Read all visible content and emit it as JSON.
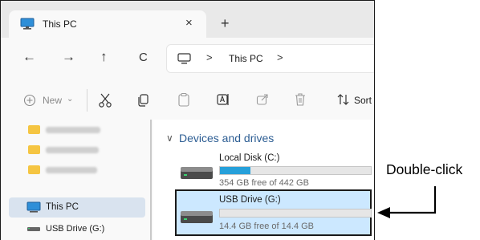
{
  "window": {
    "tab_title": "This PC",
    "tab_close": "×",
    "new_tab": "+"
  },
  "nav": {
    "back": "←",
    "forward": "→",
    "up": "↑",
    "refresh": "C",
    "sep": ">",
    "address_label": "This PC",
    "address_sep": ">"
  },
  "toolbar": {
    "new_label": "New",
    "sort_label": "Sort",
    "icons": [
      "plus-circle-icon",
      "cut-icon",
      "copy-icon",
      "paste-icon",
      "rename-icon",
      "share-icon",
      "delete-icon",
      "sort-icon"
    ]
  },
  "sidebar": {
    "this_pc": "This PC",
    "usb_drive": "USB Drive (G:)"
  },
  "main": {
    "section_title": "Devices and drives",
    "drives": [
      {
        "name": "Local Disk (C:)",
        "free_text": "354 GB free of 442 GB",
        "used_fraction": 0.2
      },
      {
        "name": "USB Drive (G:)",
        "free_text": "14.4 GB free of 14.4 GB",
        "used_fraction": 0.0
      }
    ]
  },
  "annotation": {
    "callout": "Double-click"
  },
  "colors": {
    "accent": "#26a0da",
    "selection": "#cce8ff",
    "section_title": "#2c5d93"
  }
}
